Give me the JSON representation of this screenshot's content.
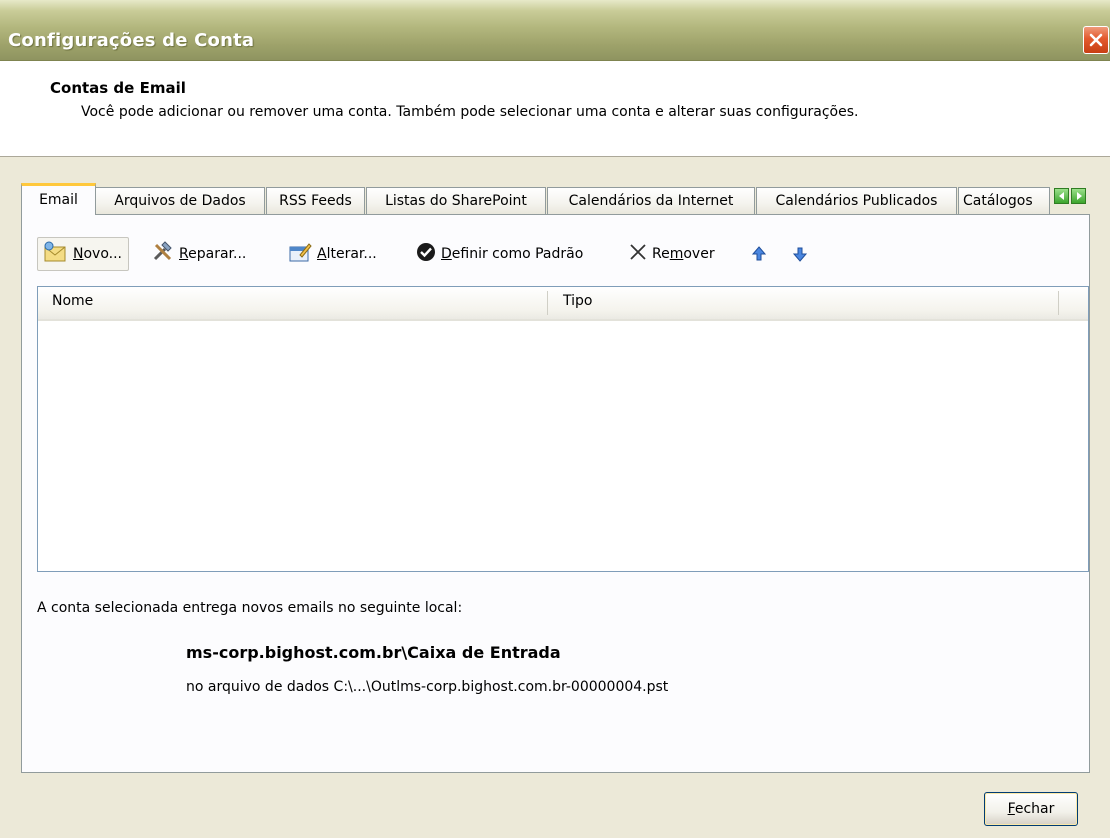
{
  "window": {
    "title": "Configurações de Conta",
    "close_icon": "close-icon"
  },
  "header": {
    "title": "Contas de Email",
    "description": "Você pode adicionar ou remover uma conta. Também pode selecionar uma conta e alterar suas configurações."
  },
  "tabs": [
    {
      "label": "Email",
      "active": true
    },
    {
      "label": "Arquivos de Dados"
    },
    {
      "label": "RSS Feeds"
    },
    {
      "label": "Listas do SharePoint"
    },
    {
      "label": "Calendários da Internet"
    },
    {
      "label": "Calendários Publicados"
    },
    {
      "label": "Catálogos"
    }
  ],
  "toolbar": {
    "new": {
      "pre": "",
      "acc": "N",
      "post": "ovo..."
    },
    "repair": {
      "pre": "",
      "acc": "R",
      "post": "eparar..."
    },
    "change": {
      "pre": "",
      "acc": "A",
      "post": "lterar..."
    },
    "default": {
      "pre": "",
      "acc": "D",
      "post": "efinir como Padrão"
    },
    "remove": {
      "pre": "Re",
      "acc": "m",
      "post": "over"
    }
  },
  "list": {
    "columns": [
      "Nome",
      "Tipo"
    ],
    "rows": []
  },
  "delivery": {
    "info": "A conta selecionada entrega novos emails no seguinte local:",
    "location": "ms-corp.bighost.com.br\\Caixa de Entrada",
    "file": "no arquivo de dados C:\\...\\Outlms-corp.bighost.com.br-00000004.pst"
  },
  "footer": {
    "close": {
      "acc": "F",
      "post": "echar"
    }
  },
  "colors": {
    "titlebar": "#9ea26a",
    "dialog_bg": "#ece9d8",
    "active_tab_accent": "#ffc83c",
    "close_red": "#e35a2d"
  }
}
